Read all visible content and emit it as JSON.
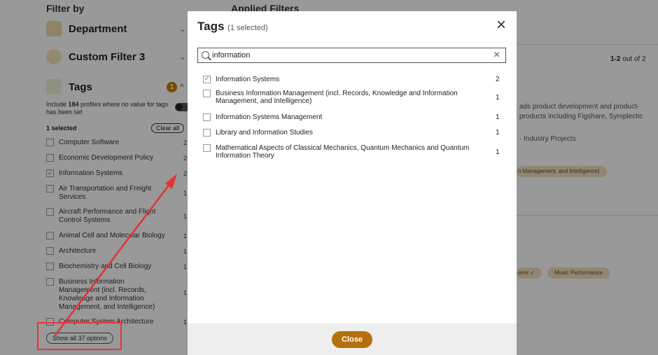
{
  "background": {
    "filter_by": "Filter by",
    "applied_filters": "Applied Filters",
    "facets": [
      {
        "label": "Department",
        "icon": "department-icon"
      },
      {
        "label": "Custom Filter 3",
        "icon": "custom-filter-icon"
      },
      {
        "label": "Tags",
        "icon": "tags-icon"
      }
    ],
    "tags_selected_count": "1",
    "include_text_prefix": "Include ",
    "include_count": "184",
    "include_text_suffix": " profiles where no value for tags has been set",
    "selected_label": "1 selected",
    "clear_all": "Clear all",
    "options": [
      {
        "label": "Computer Software",
        "count": "2",
        "checked": false
      },
      {
        "label": "Economic Development Policy",
        "count": "2",
        "checked": false
      },
      {
        "label": "Information Systems",
        "count": "2",
        "checked": true
      },
      {
        "label": "Air Transportation and Freight Services",
        "count": "1",
        "checked": false
      },
      {
        "label": "Aircraft Performance and Flight Control Systems",
        "count": "1",
        "checked": false
      },
      {
        "label": "Animal Cell and Molecular Biology",
        "count": "1",
        "checked": false
      },
      {
        "label": "Architecture",
        "count": "1",
        "checked": false
      },
      {
        "label": "Biochemistry and Cell Biology",
        "count": "1",
        "checked": false
      },
      {
        "label": "Business Information Management (incl. Records, Knowledge and Information Management, and Intelligence)",
        "count": "1",
        "checked": false
      },
      {
        "label": "Computer System Architecture",
        "count": "1",
        "checked": false
      }
    ],
    "show_all": "Show all 37 options",
    "results_range_bold": "1-2",
    "results_range_rest": " out of 2",
    "snippet_line1": "ads product development and product-",
    "snippet_line2": "products including Figshare, Symplectic",
    "industry_projects": "·  Industry Projects",
    "chip_1": "n Management, and Intelligence)",
    "chip_2": "ems ✓",
    "chip_3": "Music Performance"
  },
  "modal": {
    "title": "Tags",
    "subtitle": "(1 selected)",
    "close_icon": "×",
    "search_value": "information",
    "search_clear": "×",
    "options": [
      {
        "label": "Information Systems",
        "count": "2",
        "checked": true
      },
      {
        "label": "Business Information Management (incl. Records, Knowledge and Information Management, and Intelligence)",
        "count": "1",
        "checked": false
      },
      {
        "label": "Information Systems Management",
        "count": "1",
        "checked": false
      },
      {
        "label": "Library and Information Studies",
        "count": "1",
        "checked": false
      },
      {
        "label": "Mathematical Aspects of Classical Mechanics, Quantum Mechanics and Quantum Information Theory",
        "count": "1",
        "checked": false
      }
    ],
    "close_button": "Close"
  },
  "colors": {
    "accent": "#b6700b",
    "annotation": "#e33333",
    "chip_bg": "#f2dfbd"
  }
}
